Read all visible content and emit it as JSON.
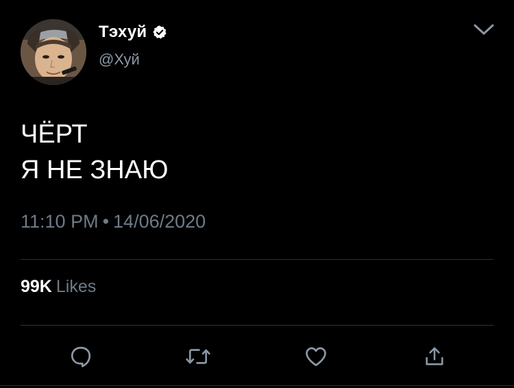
{
  "author": {
    "display_name": "Тэхуй",
    "handle": "@Хуй",
    "verified": true,
    "avatar_icon": "user-avatar-photo"
  },
  "menu": {
    "icon": "chevron-down-icon"
  },
  "tweet": {
    "lines": [
      "ЧЁРТ",
      "Я НЕ ЗНАЮ"
    ]
  },
  "meta": {
    "time": "11:10 PM",
    "separator": "•",
    "date": "14/06/2020"
  },
  "stats": {
    "likes_count": "99K",
    "likes_label": "Likes"
  },
  "actions": {
    "reply_icon": "reply-icon",
    "retweet_icon": "retweet-icon",
    "like_icon": "heart-icon",
    "share_icon": "share-icon"
  },
  "colors": {
    "background": "#000000",
    "primary_text": "#ffffff",
    "secondary_text": "#6e7b88",
    "divider": "#2f3336",
    "icon": "#8b98a5"
  }
}
